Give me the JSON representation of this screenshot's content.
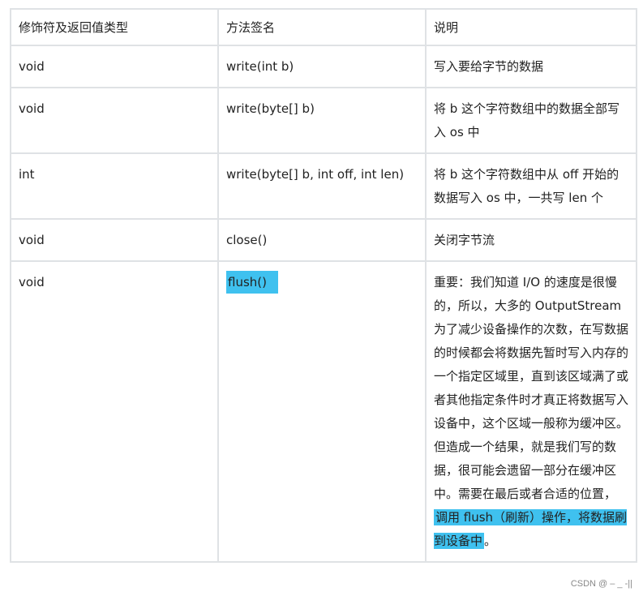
{
  "table": {
    "headers": [
      "修饰符及返回值类型",
      "方法签名",
      "说明"
    ],
    "rows": [
      {
        "type": "void",
        "signature": "write(int b)",
        "desc": "写入要给字节的数据"
      },
      {
        "type": "void",
        "signature": "write(byte[] b)",
        "desc": "将 b 这个字符数组中的数据全部写入 os 中"
      },
      {
        "type": "int",
        "signature": "write(byte[] b, int off, int len)",
        "desc": "将 b 这个字符数组中从 off 开始的数据写入 os 中，一共写 len 个"
      },
      {
        "type": "void",
        "signature": "close()",
        "desc": "关闭字节流"
      },
      {
        "type": "void",
        "signature": "flush()",
        "desc_part1": "重要：我们知道 I/O 的速度是很慢的，所以，大多的 OutputStream 为了减少设备操作的次数，在写数据的时候都会将数据先暂时写入内存的一个指定区域里，直到该区域满了或者其他指定条件时才真正将数据写入设备中，这个区域一般称为缓冲区。但造成一个结果，就是我们写的数据，很可能会遗留一部分在缓冲区中。需要在最后或者合适的位置，",
        "desc_highlight": "调用 flush（刷新）操作，将数据刷到设备中",
        "desc_end": "。"
      }
    ]
  },
  "highlight_color": "#3fc1ef",
  "watermark": "CSDN @ – _ -||"
}
